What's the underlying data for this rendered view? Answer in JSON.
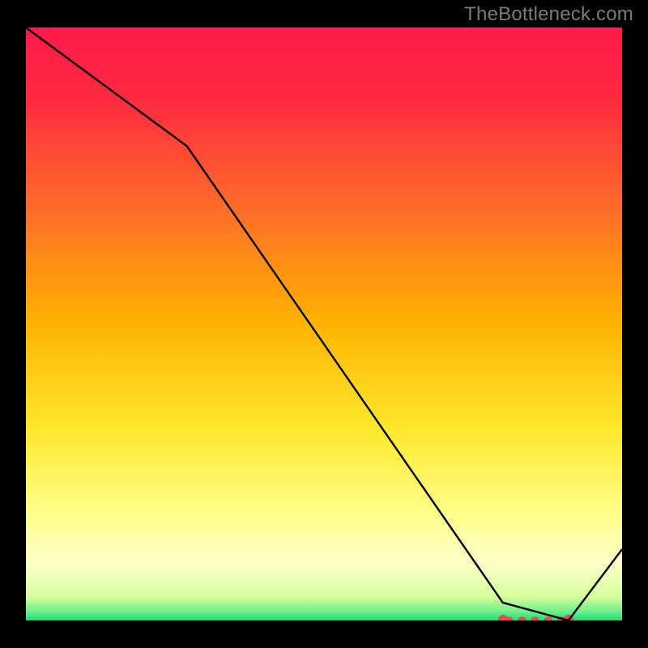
{
  "attribution": "TheBottleneck.com",
  "chart_data": {
    "type": "line",
    "title": "",
    "xlabel": "",
    "ylabel": "",
    "xlim": [
      0,
      100
    ],
    "ylim": [
      0,
      100
    ],
    "x": [
      0,
      27,
      80,
      91,
      100
    ],
    "values": [
      100,
      80,
      3,
      0,
      12
    ],
    "optimal_range": {
      "x_start": 80,
      "x_end": 91,
      "y": 0
    },
    "background": {
      "type": "heat-gradient",
      "stops": [
        {
          "pos": 0.0,
          "color": "#ff1a4a"
        },
        {
          "pos": 0.12,
          "color": "#ff2a3f"
        },
        {
          "pos": 0.3,
          "color": "#ff6a2a"
        },
        {
          "pos": 0.5,
          "color": "#ffb300"
        },
        {
          "pos": 0.68,
          "color": "#ffe92e"
        },
        {
          "pos": 0.82,
          "color": "#ffff8a"
        },
        {
          "pos": 0.9,
          "color": "#ffffc8"
        },
        {
          "pos": 0.96,
          "color": "#d8ff9e"
        },
        {
          "pos": 0.985,
          "color": "#6cf08a"
        },
        {
          "pos": 1.0,
          "color": "#1edc7a"
        }
      ]
    },
    "line_color": "#000000",
    "marker_color": "#e94b4b"
  }
}
